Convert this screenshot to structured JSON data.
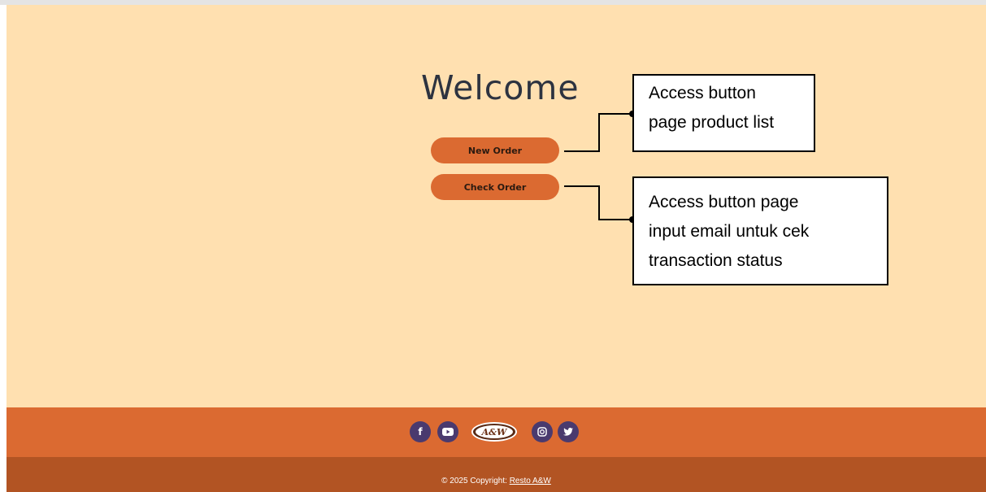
{
  "main": {
    "welcome_title": "Welcome",
    "new_order_label": "New Order",
    "check_order_label": "Check Order"
  },
  "annotations": {
    "callout1_lines": [
      "Access button",
      "page product list"
    ],
    "callout2_lines": [
      "Access button page",
      "input email untuk cek",
      "transaction status"
    ]
  },
  "footer": {
    "social_icons": [
      "facebook-icon",
      "youtube-icon",
      "logo-aw",
      "instagram-icon",
      "twitter-icon"
    ],
    "logo_text": "A&W",
    "copyright_prefix": "© 2025 Copyright: ",
    "copyright_link": "Resto A&W"
  },
  "colors": {
    "background": "#ffe0b0",
    "button": "#db6a31",
    "footer": "#db6a31",
    "copyright_bar": "#b25423",
    "social_circle": "#4a3a6e"
  }
}
